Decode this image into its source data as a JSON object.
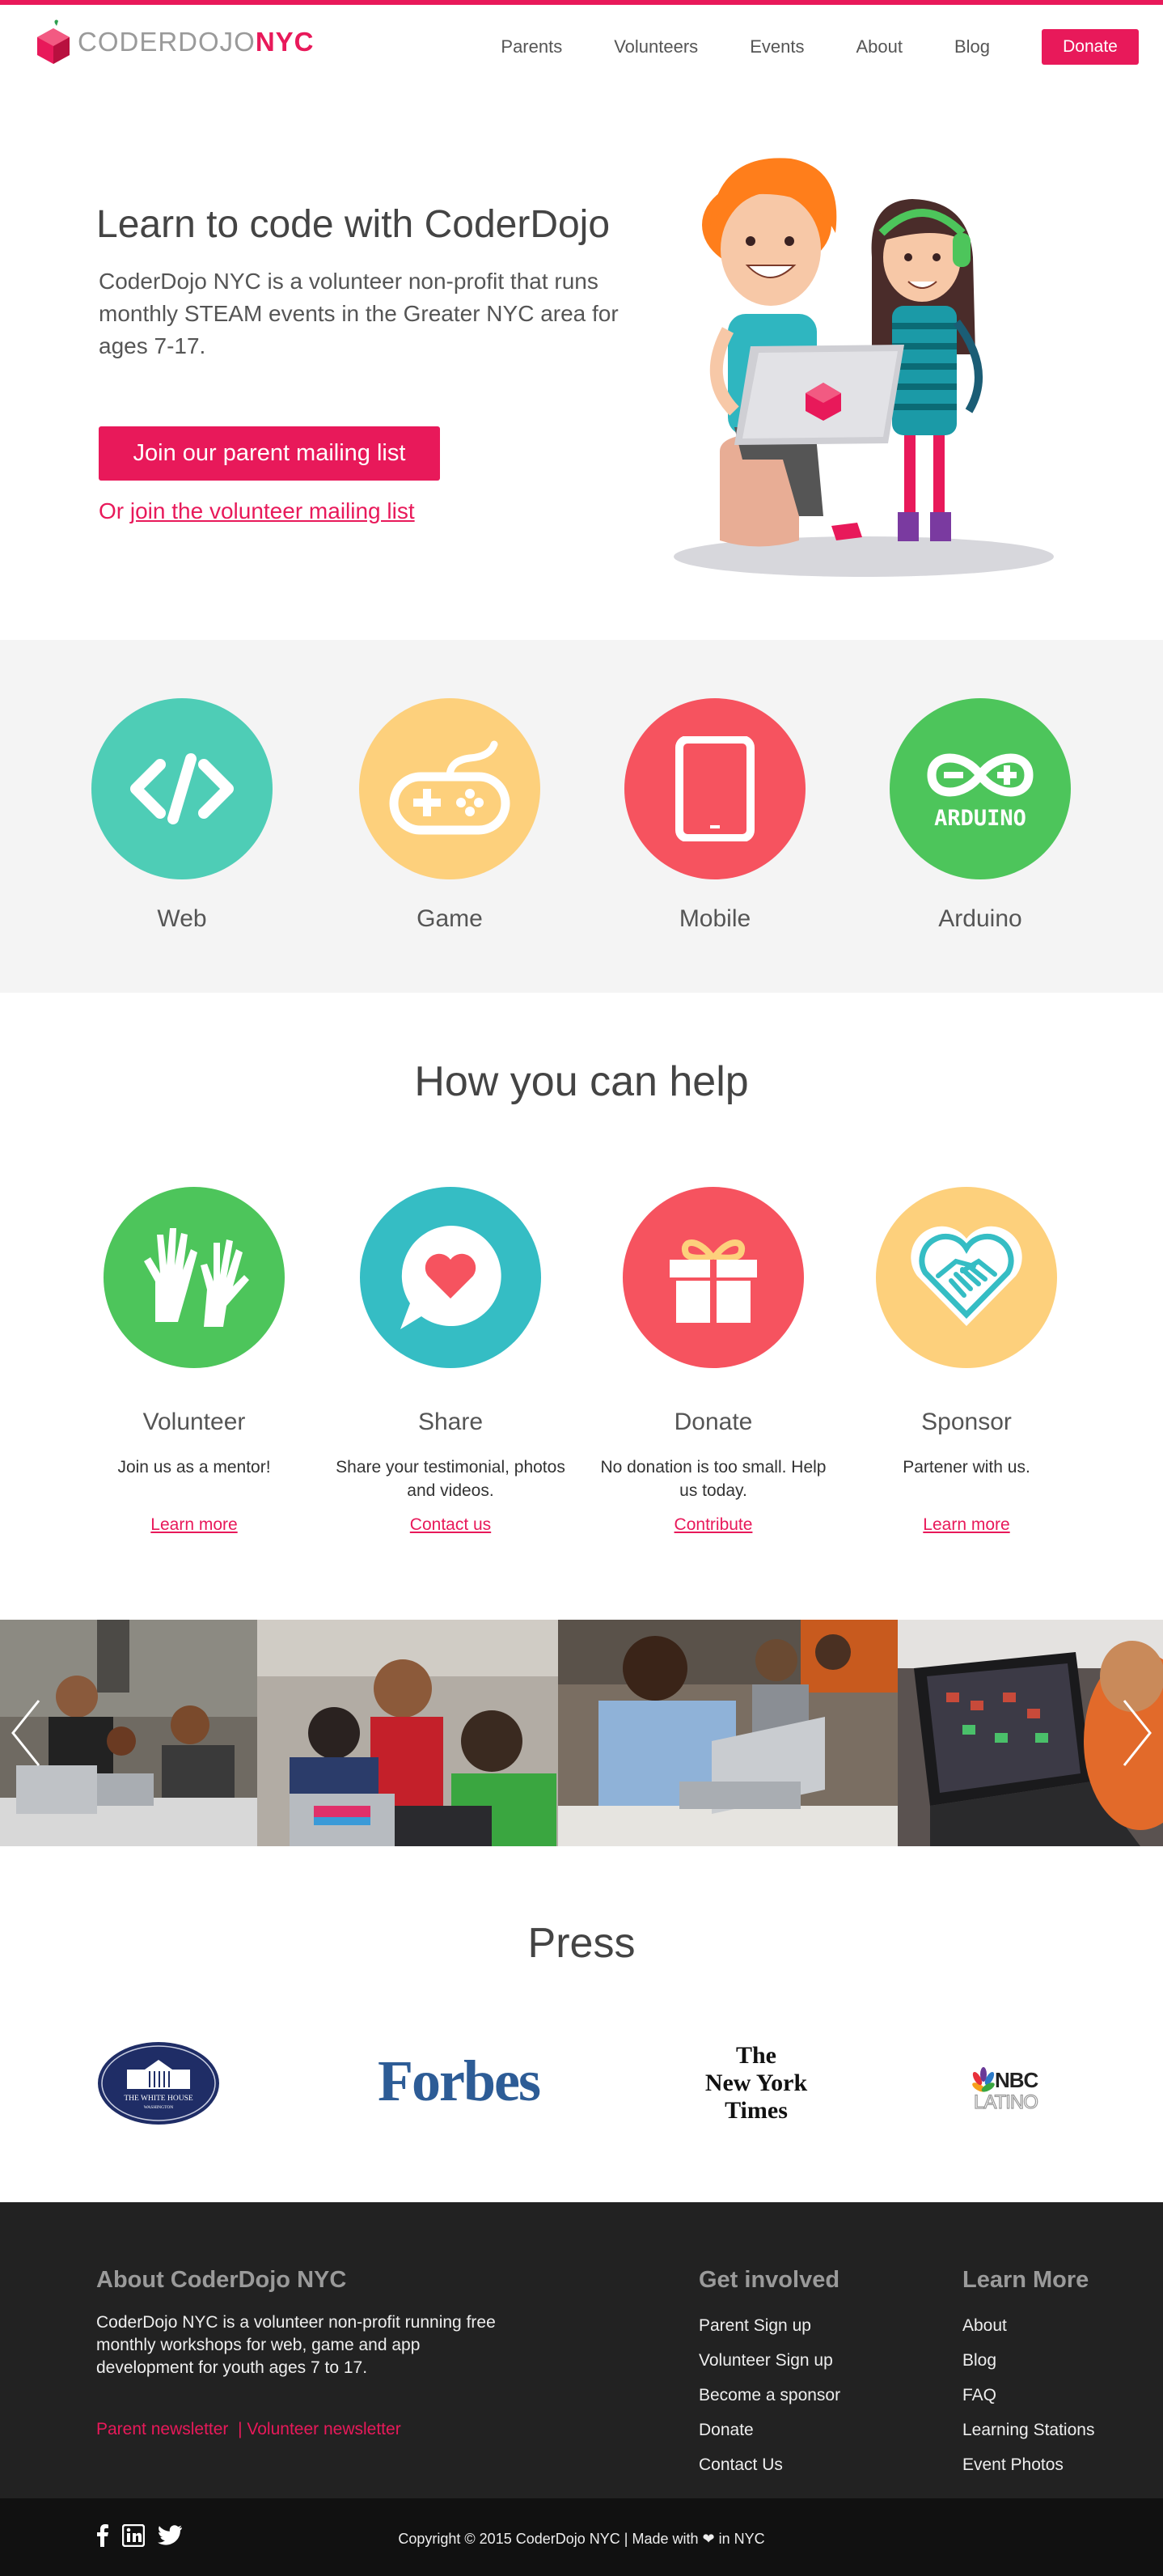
{
  "brand": {
    "name_light": "CODERDOJO",
    "name_bold": "NYC",
    "accent": "#e8195a"
  },
  "nav": {
    "items": [
      "Parents",
      "Volunteers",
      "Events",
      "About",
      "Blog"
    ],
    "donate": "Donate"
  },
  "hero": {
    "title": "Learn to code with CoderDojo",
    "description": "CoderDojo NYC is a volunteer non-profit that runs monthly STEAM events in the Greater NYC area for ages 7-17.",
    "cta": "Join our parent mailing list",
    "or_prefix": "Or",
    "secondary_link": "join the volunteer mailing list"
  },
  "topics": [
    {
      "label": "Web",
      "color": "#4ecdb6",
      "icon": "code-icon"
    },
    {
      "label": "Game",
      "color": "#fdd07c",
      "icon": "gamepad-icon"
    },
    {
      "label": "Mobile",
      "color": "#f6535f",
      "icon": "tablet-icon"
    },
    {
      "label": "Arduino",
      "color": "#4dc55b",
      "icon": "arduino-icon",
      "icon_text": "ARDUINO"
    }
  ],
  "help": {
    "title": "How you can help",
    "items": [
      {
        "title": "Volunteer",
        "desc": "Join us as a mentor!",
        "link": "Learn more",
        "color": "#4dc55b",
        "icon": "raised-hands-icon"
      },
      {
        "title": "Share",
        "desc": "Share your testimonial, photos and videos.",
        "link": "Contact us",
        "color": "#35bdc4",
        "icon": "heart-bubble-icon"
      },
      {
        "title": "Donate",
        "desc": "No donation is too small. Help us today.",
        "link": "Contribute",
        "color": "#f6535f",
        "icon": "gift-icon"
      },
      {
        "title": "Sponsor",
        "desc": "Partener with us.",
        "link": "Learn more",
        "color": "#fdd07c",
        "icon": "handshake-heart-icon"
      }
    ]
  },
  "press": {
    "title": "Press",
    "logos": [
      {
        "name": "white-house-logo",
        "line1": "THE WHITE HOUSE",
        "line2": "WASHINGTON"
      },
      {
        "name": "forbes-logo",
        "text": "Forbes"
      },
      {
        "name": "nyt-logo",
        "lines": [
          "The",
          "New York",
          "Times"
        ]
      },
      {
        "name": "nbc-latino-logo",
        "line1": "NBC",
        "line2": "LATINO"
      }
    ]
  },
  "footer": {
    "about_title": "About CoderDojo NYC",
    "about_text": "CoderDojo NYC is a volunteer non-profit running free monthly workshops for web, game and app development for youth ages 7 to 17.",
    "parent_newsletter": "Parent newsletter",
    "separator": "|",
    "volunteer_newsletter": "Volunteer newsletter",
    "get_involved": {
      "title": "Get involved",
      "links": [
        "Parent Sign up",
        "Volunteer Sign up",
        "Become a sponsor",
        "Donate",
        "Contact Us"
      ]
    },
    "learn_more": {
      "title": "Learn More",
      "links": [
        "About",
        "Blog",
        "FAQ",
        "Learning Stations",
        "Event Photos"
      ]
    },
    "copyright_before": "Copyright © 2015 CoderDojo NYC | Made with",
    "copyright_heart": "❤",
    "copyright_after": "in NYC"
  }
}
